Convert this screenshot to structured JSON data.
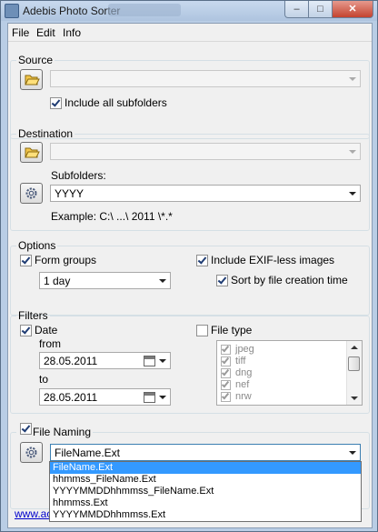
{
  "window": {
    "title": "Adebis Photo Sorter",
    "min": "–",
    "max": "□",
    "close": "✕"
  },
  "menu": [
    "File",
    "Edit",
    "Info"
  ],
  "source": {
    "legend": "Source",
    "path_value": "",
    "include_subfolders_label": "Include all subfolders",
    "include_subfolders_checked": true
  },
  "destination": {
    "legend": "Destination",
    "path_value": "",
    "subfolders_label": "Subfolders:",
    "subfolders_value": "YYYY",
    "example": "Example: C:\\ ...\\ 2011 \\*.*"
  },
  "options": {
    "legend": "Options",
    "form_groups_label": "Form groups",
    "form_groups_checked": true,
    "group_value": "1 day",
    "include_exifless_label": "Include EXIF-less images",
    "include_exifless_checked": true,
    "sort_by_time_label": "Sort by file creation time",
    "sort_by_time_checked": true
  },
  "filters": {
    "legend": "Filters",
    "date_label": "Date",
    "date_checked": true,
    "from_label": "from",
    "from_value": "28.05.2011",
    "to_label": "to",
    "to_value": "28.05.2011",
    "file_type_label": "File type",
    "file_type_checked": false,
    "file_types": [
      "jpeg",
      "tiff",
      "dng",
      "nef",
      "nrw"
    ]
  },
  "file_naming": {
    "legend": "File Naming",
    "checked": true,
    "value": "FileName.Ext",
    "options": [
      "FileName.Ext",
      "hhmmss_FileName.Ext",
      "YYYYMMDDhhmmss_FileName.Ext",
      "hhmmss.Ext",
      "YYYYMMDDhhmmss.Ext"
    ],
    "selected_index": 0
  },
  "footer": {
    "link_text": "www.ac"
  },
  "icons": {
    "folder": "folder-icon",
    "gear": "gear-icon"
  }
}
